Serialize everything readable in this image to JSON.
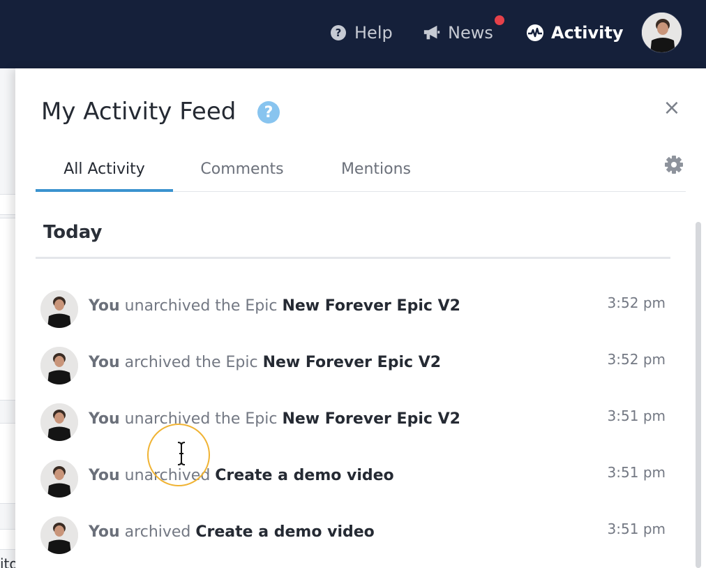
{
  "nav": {
    "help_label": "Help",
    "news_label": "News",
    "activity_label": "Activity",
    "help_icon": "question-circle-icon",
    "news_icon": "megaphone-icon",
    "activity_icon": "pulse-icon",
    "news_badge_color": "#e5414a"
  },
  "panel": {
    "title": "My Activity Feed",
    "help_glyph": "?",
    "close_glyph": "×",
    "tabs": [
      {
        "label": "All Activity",
        "active": true
      },
      {
        "label": "Comments",
        "active": false
      },
      {
        "label": "Mentions",
        "active": false
      }
    ],
    "section": "Today",
    "accent_color": "#3b93cf"
  },
  "feed": [
    {
      "actor": "You",
      "action": " unarchived the Epic ",
      "object": "New Forever Epic V2",
      "time": "3:52 pm"
    },
    {
      "actor": "You",
      "action": " archived the Epic ",
      "object": "New Forever Epic V2",
      "time": "3:52 pm"
    },
    {
      "actor": "You",
      "action": " unarchived the Epic ",
      "object": "New Forever Epic V2",
      "time": "3:51 pm"
    },
    {
      "actor": "You",
      "action": " unarchived ",
      "object": "Create a demo video",
      "time": "3:51 pm"
    },
    {
      "actor": "You",
      "action": " archived ",
      "object": "Create a demo video",
      "time": "3:51 pm"
    }
  ],
  "background": {
    "partial_text": "ito"
  }
}
